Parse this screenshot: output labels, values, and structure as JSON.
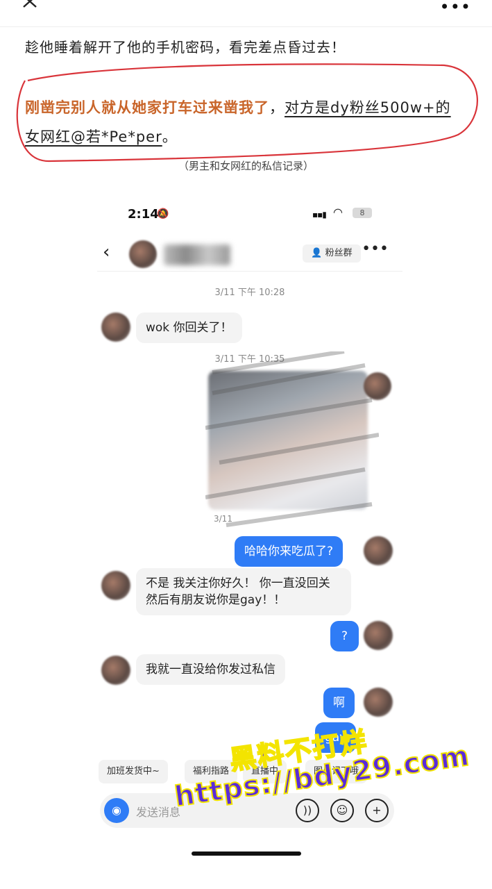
{
  "post": {
    "line1": "趁他睡着解开了他的手机密码，看完差点昏过去！",
    "highlight_orange": "刚凿完别人就从她家打车过来凿我了",
    "highlight_comma": "，",
    "highlight_underline1": "对方是dy粉丝500w+的",
    "highlight_underline2": "女网红@若*Pe*per",
    "highlight_end": "。",
    "caption": "（男主和女网红的私信记录）"
  },
  "phone": {
    "status": {
      "time": "2:14",
      "battery": "8"
    },
    "header": {
      "fans_group": "粉丝群"
    },
    "messages": {
      "ts1": "3/11 下午 10:28",
      "m1": "wok 你回关了！",
      "ts2": "3/11 下午 10:35",
      "img_label": "3/11",
      "m2": "哈哈你来吃瓜了?",
      "m3": "不是 我关注你好久！ 你一直没回关 然后有朋友说你是gay！！",
      "m4": "?",
      "m5": "我就一直没给你发过私信",
      "m6": "啊",
      "m7": "gay"
    },
    "chips": [
      "加班发货中~",
      "福利指路",
      "直播中",
      "图片记下哦"
    ],
    "input": {
      "placeholder": "发送消息"
    }
  },
  "watermark": {
    "line1": "黑料不打烊",
    "line2": "https://bdy29.com"
  },
  "colors": {
    "accent_blue": "#2f7cf6",
    "highlight_orange": "#c9652a",
    "loop_red": "#d9343a"
  }
}
